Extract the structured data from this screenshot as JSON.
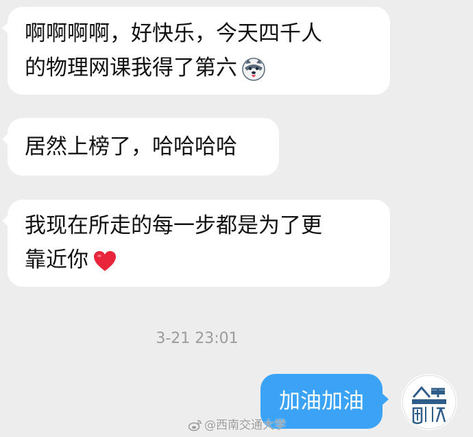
{
  "messages": {
    "received": [
      {
        "lines": [
          "啊啊啊啊，好快乐，今天四千人",
          "的物理网课我得了第六"
        ],
        "emoji": "husky-dog-emoji"
      },
      {
        "lines": [
          "居然上榜了，哈哈哈哈"
        ]
      },
      {
        "lines": [
          "我现在所走的每一步都是为了更",
          "靠近你"
        ],
        "emoji": "red-heart-emoji"
      }
    ],
    "timestamp": "3-21 23:01",
    "sent": {
      "text": "加油加油"
    }
  },
  "avatar": {
    "icon": "university-emblem-icon",
    "color": "#2f5d8a"
  },
  "watermark": {
    "text": "@西南交通大学",
    "icon": "weibo-icon"
  },
  "colors": {
    "background": "#ededed",
    "received_bubble": "#ffffff",
    "sent_bubble": "#3ba3f5"
  }
}
